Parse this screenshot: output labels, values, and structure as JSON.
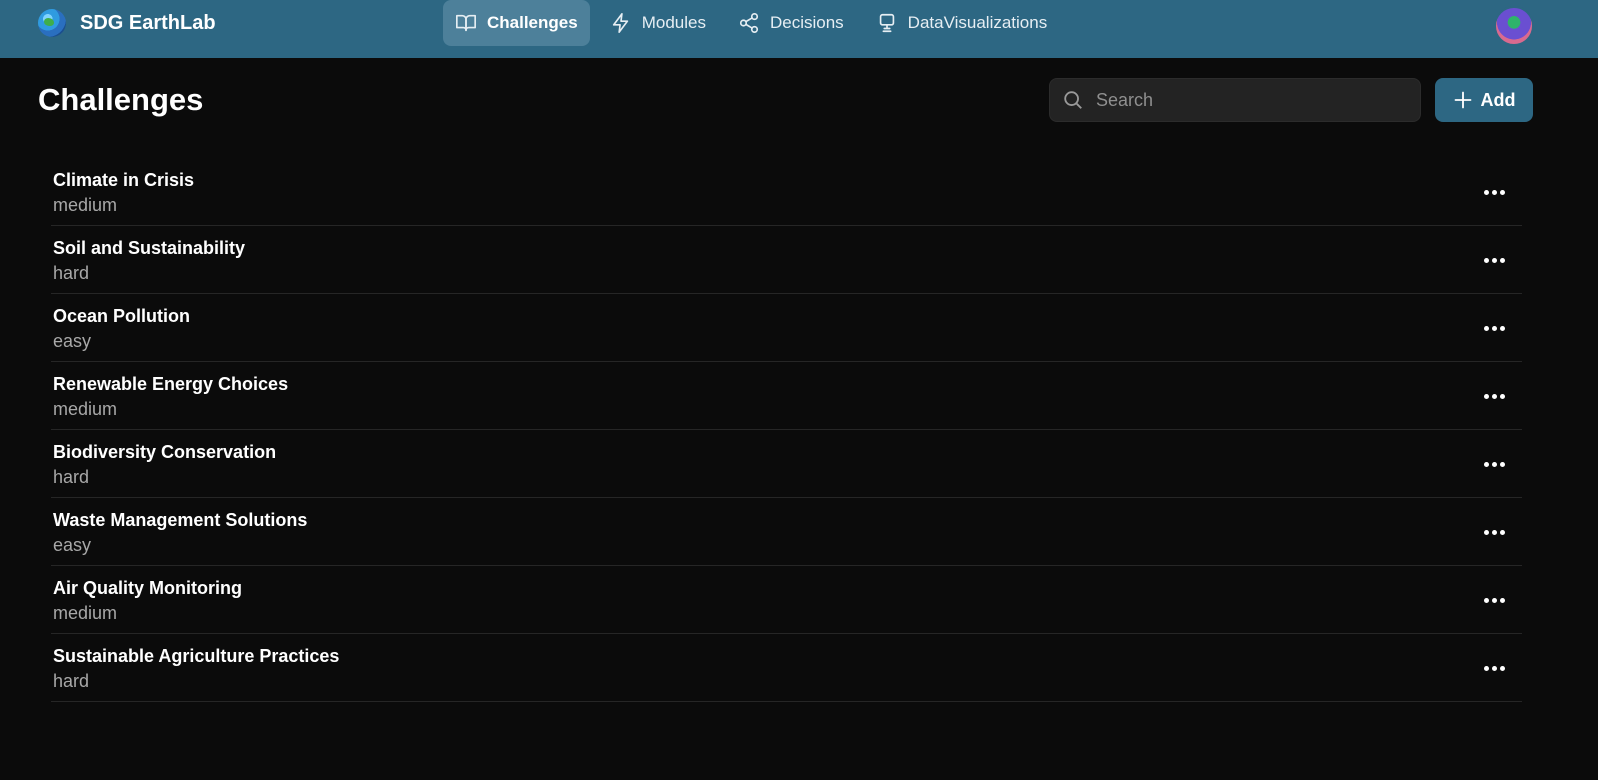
{
  "app": {
    "brand_name": "SDG EarthLab"
  },
  "nav": [
    {
      "label": "Challenges",
      "icon": "book-open-icon",
      "active": true
    },
    {
      "label": "Modules",
      "icon": "lightning-icon",
      "active": false
    },
    {
      "label": "Decisions",
      "icon": "share-nodes-icon",
      "active": false
    },
    {
      "label": "DataVisualizations",
      "icon": "monitor-icon",
      "active": false
    }
  ],
  "page": {
    "title": "Challenges",
    "search_placeholder": "Search",
    "add_label": "Add"
  },
  "challenges": [
    {
      "title": "Climate in Crisis",
      "level": "medium"
    },
    {
      "title": "Soil and Sustainability",
      "level": "hard"
    },
    {
      "title": "Ocean Pollution",
      "level": "easy"
    },
    {
      "title": "Renewable Energy Choices",
      "level": "medium"
    },
    {
      "title": "Biodiversity Conservation",
      "level": "hard"
    },
    {
      "title": "Waste Management Solutions",
      "level": "easy"
    },
    {
      "title": "Air Quality Monitoring",
      "level": "medium"
    },
    {
      "title": "Sustainable Agriculture Practices",
      "level": "hard"
    }
  ],
  "colors": {
    "topbar": "#2d6783",
    "background": "#0b0b0b",
    "active_tab": "#4d809a",
    "accent": "#2d6783"
  }
}
